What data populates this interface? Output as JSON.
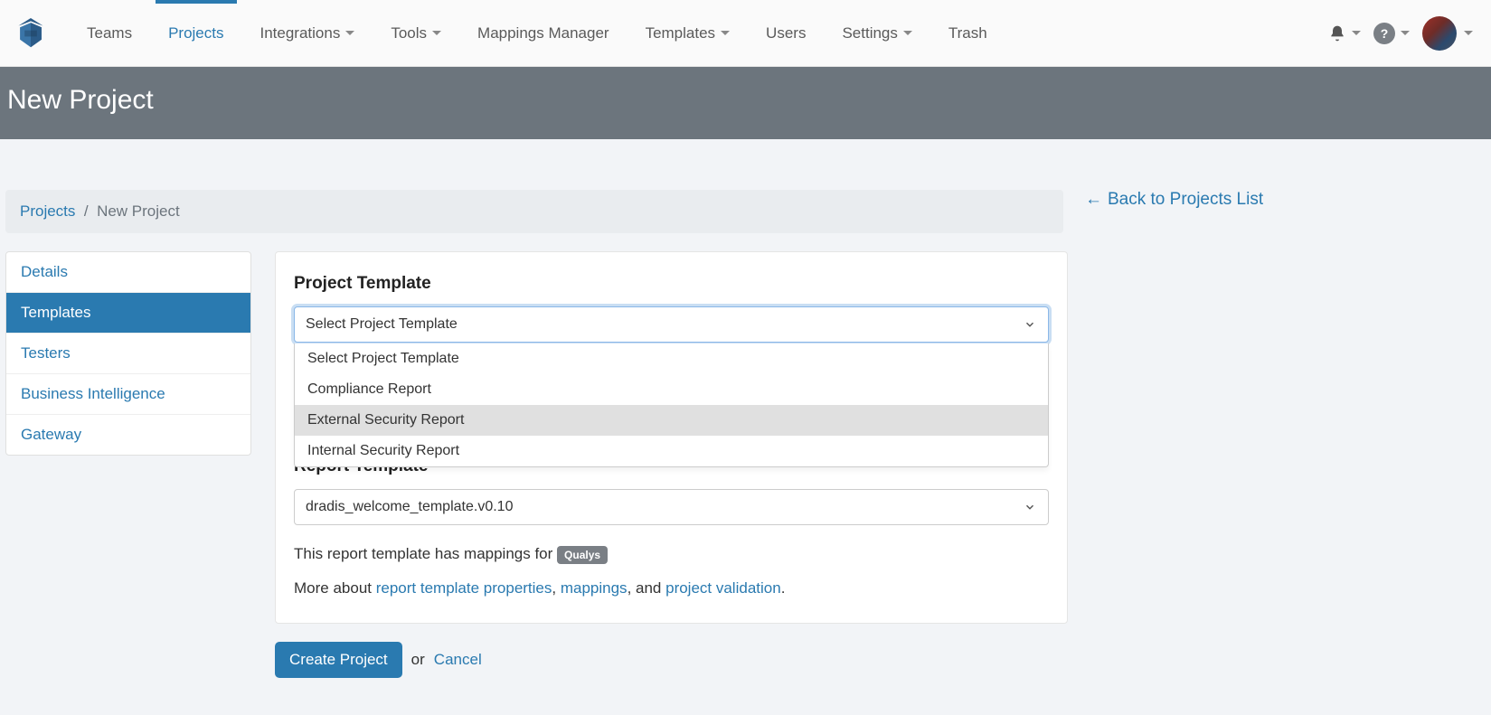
{
  "nav": {
    "items": [
      {
        "label": "Teams",
        "hasDropdown": false
      },
      {
        "label": "Projects",
        "hasDropdown": false,
        "active": true
      },
      {
        "label": "Integrations",
        "hasDropdown": true
      },
      {
        "label": "Tools",
        "hasDropdown": true
      },
      {
        "label": "Mappings Manager",
        "hasDropdown": false
      },
      {
        "label": "Templates",
        "hasDropdown": true
      },
      {
        "label": "Users",
        "hasDropdown": false
      },
      {
        "label": "Settings",
        "hasDropdown": true
      },
      {
        "label": "Trash",
        "hasDropdown": false
      }
    ]
  },
  "header": {
    "title": "New Project"
  },
  "breadcrumb": {
    "root": "Projects",
    "sep": "/",
    "current": "New Project"
  },
  "back_link": {
    "arrow": "←",
    "label": "Back to Projects List"
  },
  "sidebar": {
    "items": [
      {
        "label": "Details"
      },
      {
        "label": "Templates",
        "active": true
      },
      {
        "label": "Testers"
      },
      {
        "label": "Business Intelligence"
      },
      {
        "label": "Gateway"
      }
    ]
  },
  "form": {
    "project_template": {
      "title": "Project Template",
      "selected": "Select Project Template",
      "options": [
        "Select Project Template",
        "Compliance Report",
        "External Security Report",
        "Internal Security Report"
      ],
      "highlighted_index": 2
    },
    "report_template": {
      "title": "Report Template",
      "selected": "dradis_welcome_template.v0.10"
    },
    "mapping_text_prefix": "This report template has mappings for ",
    "mapping_badge": "Qualys",
    "more_about_prefix": "More about ",
    "link_rtp": "report template properties",
    "sep1": ", ",
    "link_mappings": "mappings",
    "sep2": ", and ",
    "link_validation": "project validation",
    "period": "."
  },
  "footer": {
    "submit": "Create Project",
    "or": "or",
    "cancel": "Cancel"
  }
}
